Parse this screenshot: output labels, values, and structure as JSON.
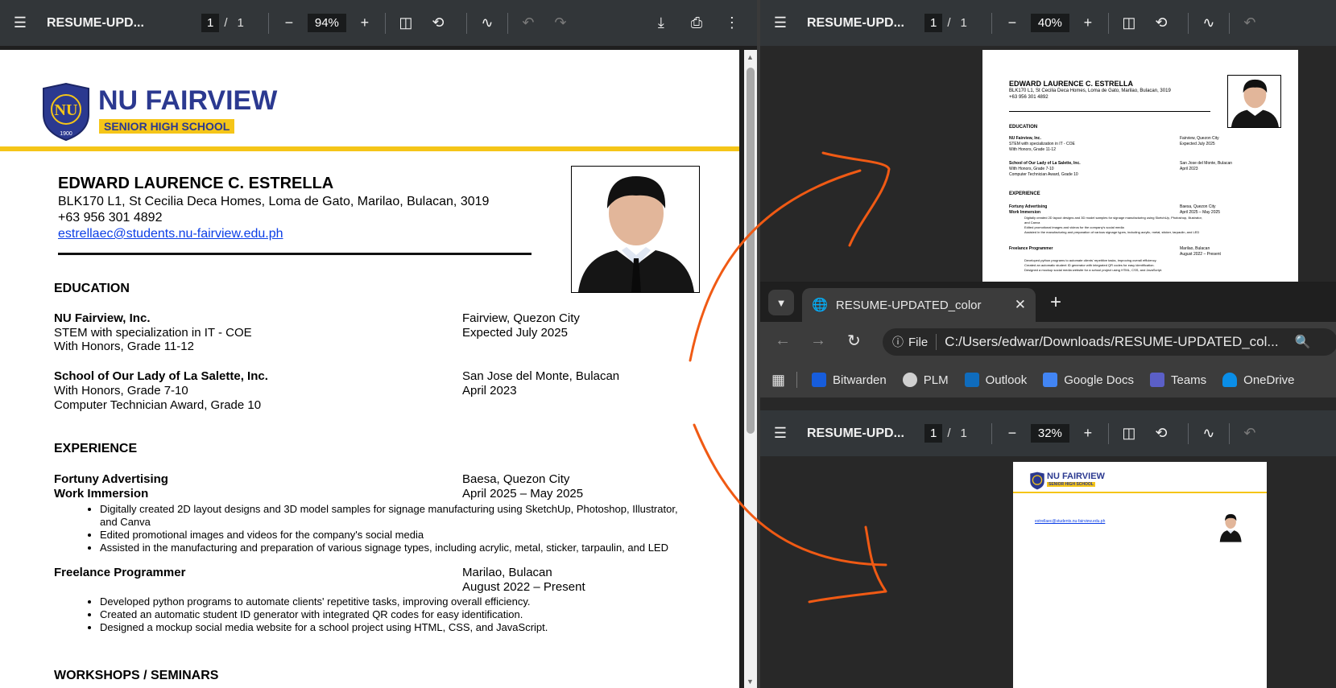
{
  "viewer_left": {
    "title": "RESUME-UPD...",
    "page_current": "1",
    "page_sep": "/",
    "page_total": "1",
    "zoom": "94%"
  },
  "viewer_right_top": {
    "title": "RESUME-UPD...",
    "page_current": "1",
    "page_sep": "/",
    "page_total": "1",
    "zoom": "40%"
  },
  "viewer_right_bottom": {
    "title": "RESUME-UPD...",
    "page_current": "1",
    "page_sep": "/",
    "page_total": "1",
    "zoom": "32%"
  },
  "browser": {
    "tab_title": "RESUME-UPDATED_color",
    "url_label": "File",
    "url": "C:/Users/edwar/Downloads/RESUME-UPDATED_col...",
    "bookmarks": [
      "Bitwarden",
      "PLM",
      "Outlook",
      "Google Docs",
      "Teams",
      "OneDrive"
    ]
  },
  "resume": {
    "school_logo_name": "NU FAIRVIEW",
    "school_logo_sub": "SENIOR HIGH SCHOOL",
    "logo_year": "1900",
    "name": "EDWARD LAURENCE C. ESTRELLA",
    "address": "BLK170 L1, St Cecilia Deca Homes, Loma de Gato, Marilao, Bulacan, 3019",
    "phone": "+63 956 301 4892",
    "email": "estrellaec@students.nu-fairview.edu.ph",
    "education_heading": "EDUCATION",
    "edu1_school": "NU Fairview, Inc.",
    "edu1_line1": "STEM with specialization in IT - COE",
    "edu1_line2": "With Honors, Grade 11-12",
    "edu1_place": "Fairview, Quezon City",
    "edu1_date": "Expected July 2025",
    "edu2_school": "School of Our Lady of La Salette, Inc.",
    "edu2_line1": "With Honors, Grade 7-10",
    "edu2_line2": "Computer Technician Award, Grade 10",
    "edu2_place": "San Jose del Monte, Bulacan",
    "edu2_date": "April 2023",
    "experience_heading": "EXPERIENCE",
    "exp1_company": "Fortuny Advertising",
    "exp1_role": "Work Immersion",
    "exp1_place": "Baesa, Quezon City",
    "exp1_date": "April 2025 – May 2025",
    "exp1_b1a": "Digitally created 2D layout designs and 3D model samples for signage manufacturing using SketchUp, Photoshop, Illustrator,",
    "exp1_b1b": "and Canva",
    "exp1_b2": "Edited promotional images and videos for the company's social media",
    "exp1_b3": "Assisted in the manufacturing and preparation of various signage types, including acrylic, metal, sticker, tarpaulin, and LED",
    "exp2_company": "Freelance Programmer",
    "exp2_place": "Marilao, Bulacan",
    "exp2_date": "August 2022 – Present",
    "exp2_b1": "Developed python programs to automate clients' repetitive tasks, improving overall efficiency.",
    "exp2_b2": "Created an automatic student ID generator with integrated QR codes for easy identification.",
    "exp2_b3": "Designed a mockup social media website for a school project using HTML, CSS, and JavaScript.",
    "workshops_heading": "WORKSHOPS / SEMINARS"
  },
  "colors": {
    "accent_yellow": "#f5c518",
    "nu_blue": "#2b3990",
    "annotation_orange": "#f05a14",
    "link_blue": "#0b3ee6"
  }
}
